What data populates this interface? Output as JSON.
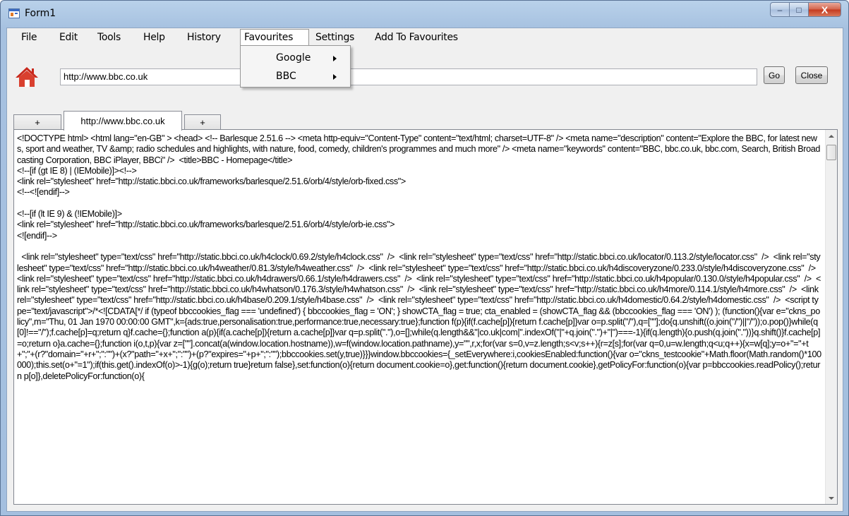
{
  "window": {
    "title": "Form1",
    "buttons": {
      "minimize": "–",
      "maximize": "□",
      "close": "X"
    }
  },
  "menu": {
    "file": "File",
    "edit": "Edit",
    "tools": "Tools",
    "help": "Help",
    "history": "History",
    "favourites": "Favourites",
    "settings": "Settings",
    "add_to_favourites": "Add To Favourites"
  },
  "favourites_dropdown": {
    "items": [
      {
        "label": "Google"
      },
      {
        "label": "BBC"
      }
    ]
  },
  "address_bar": {
    "value": "http://www.bbc.co.uk",
    "go_label": "Go",
    "close_label": "Close"
  },
  "tabs": [
    {
      "label": "+"
    },
    {
      "label": "http://www.bbc.co.uk"
    },
    {
      "label": "+"
    }
  ],
  "page_source": "<!DOCTYPE html> <html lang=\"en-GB\" > <head> <!-- Barlesque 2.51.6 --> <meta http-equiv=\"Content-Type\" content=\"text/html; charset=UTF-8\" /> <meta name=\"description\" content=\"Explore the BBC, for latest news, sport and weather, TV &amp; radio schedules and highlights, with nature, food, comedy, children's programmes and much more\" /> <meta name=\"keywords\" content=\"BBC, bbc.co.uk, bbc.com, Search, British Broadcasting Corporation, BBC iPlayer, BBCi\" />  <title>BBC - Homepage</title>\n<!--[if (gt IE 8) | (IEMobile)]><!-->\n<link rel=\"stylesheet\" href=\"http://static.bbci.co.uk/frameworks/barlesque/2.51.6/orb/4/style/orb-fixed.css\">\n<!--<![endif]-->\n\n<!--[if (lt IE 9) & (!IEMobile)]>\n<link rel=\"stylesheet\" href=\"http://static.bbci.co.uk/frameworks/barlesque/2.51.6/orb/4/style/orb-ie.css\">\n<![endif]-->\n\n  <link rel=\"stylesheet\" type=\"text/css\" href=\"http://static.bbci.co.uk/h4clock/0.69.2/style/h4clock.css\"  />  <link rel=\"stylesheet\" type=\"text/css\" href=\"http://static.bbci.co.uk/locator/0.113.2/style/locator.css\"  />  <link rel=\"stylesheet\" type=\"text/css\" href=\"http://static.bbci.co.uk/h4weather/0.81.3/style/h4weather.css\"  />  <link rel=\"stylesheet\" type=\"text/css\" href=\"http://static.bbci.co.uk/h4discoveryzone/0.233.0/style/h4discoveryzone.css\"  />  <link rel=\"stylesheet\" type=\"text/css\" href=\"http://static.bbci.co.uk/h4drawers/0.66.1/style/h4drawers.css\"  />  <link rel=\"stylesheet\" type=\"text/css\" href=\"http://static.bbci.co.uk/h4popular/0.130.0/style/h4popular.css\"  />  <link rel=\"stylesheet\" type=\"text/css\" href=\"http://static.bbci.co.uk/h4whatson/0.176.3/style/h4whatson.css\"  />  <link rel=\"stylesheet\" type=\"text/css\" href=\"http://static.bbci.co.uk/h4more/0.114.1/style/h4more.css\"  />  <link rel=\"stylesheet\" type=\"text/css\" href=\"http://static.bbci.co.uk/h4base/0.209.1/style/h4base.css\"  />  <link rel=\"stylesheet\" type=\"text/css\" href=\"http://static.bbci.co.uk/h4domestic/0.64.2/style/h4domestic.css\"  />  <script type=\"text/javascript\">/*<![CDATA[*/ if (typeof bbccookies_flag === 'undefined') { bbccookies_flag = 'ON'; } showCTA_flag = true; cta_enabled = (showCTA_flag && (bbccookies_flag === 'ON') ); (function(){var e=\"ckns_policy\",m=\"Thu, 01 Jan 1970 00:00:00 GMT\",k={ads:true,personalisation:true,performance:true,necessary:true};function f(p){if(f.cache[p]){return f.cache[p]}var o=p.split(\"/\"),q=[\"\"];do{q.unshift((o.join(\"/\")||\"/\"));o.pop()}while(q[0]!==\"/\");f.cache[p]=q;return q}f.cache={};function a(p){if(a.cache[p]){return a.cache[p]}var q=p.split(\".\"),o=[];while(q.length&&\"|co.uk|com|\".indexOf(\"|\"+q.join(\".\")+\"|\")===-1){if(q.length){o.push(q.join(\".\"))}q.shift()}f.cache[p]=o;return o}a.cache={};function i(o,t,p){var z=[\"\"].concat(a(window.location.hostname)),w=f(window.location.pathname),y=\"\",r,x;for(var s=0,v=z.length;s<v;s++){r=z[s];for(var q=0,u=w.length;q<u;q++){x=w[q];y=o+\"=\"+t+\";\"+(r?\"domain=\"+r+\";\":\"\")+(x?\"path=\"+x+\";\":\"\")+(p?\"expires=\"+p+\";\":\"\");bbccookies.set(y,true)}}}window.bbccookies={_setEverywhere:i,cookiesEnabled:function(){var o=\"ckns_testcookie\"+Math.floor(Math.random()*100000);this.set(o+\"=1\");if(this.get().indexOf(o)>-1){g(o);return true}return false},set:function(o){return document.cookie=o},get:function(){return document.cookie},getPolicyFor:function(o){var p=bbccookies.readPolicy();return p[o]},deletePolicyFor:function(o){"
}
